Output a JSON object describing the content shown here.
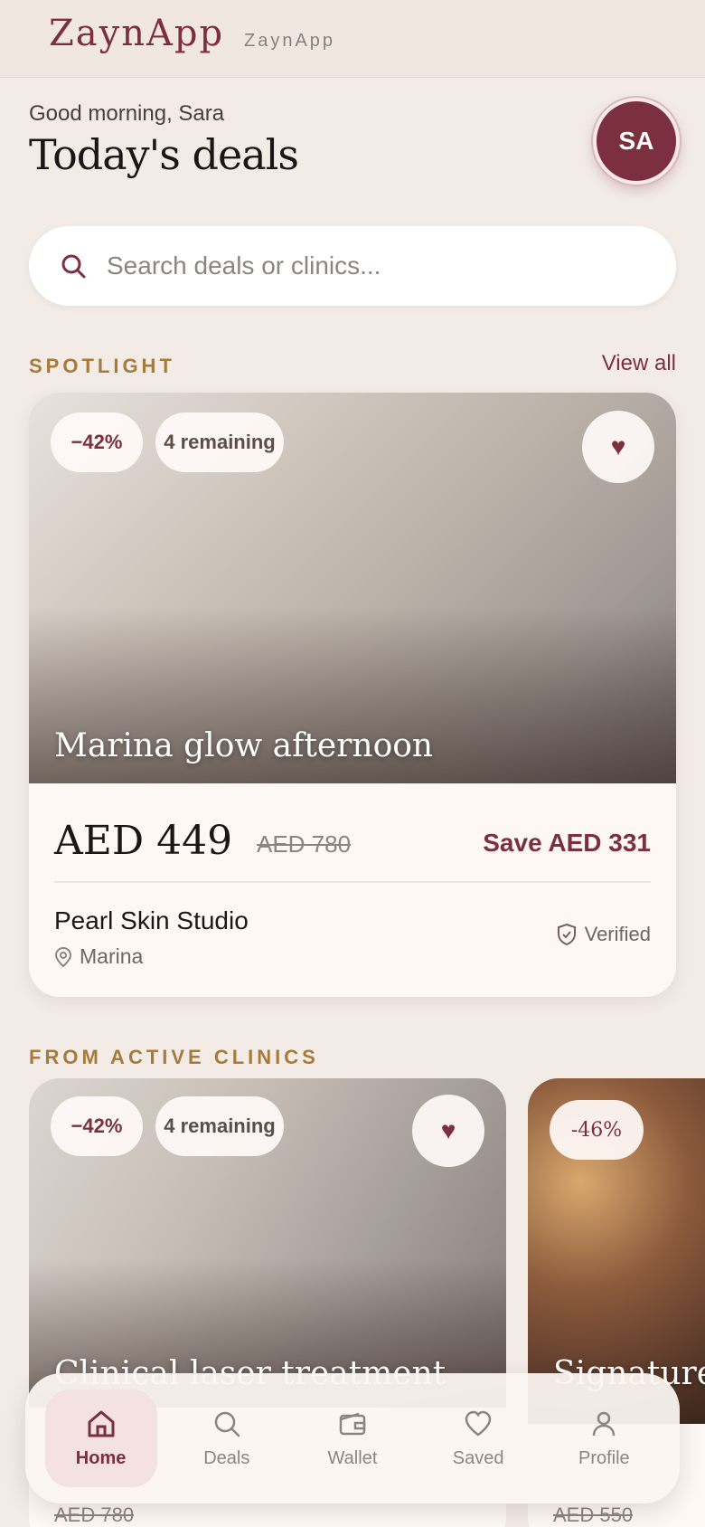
{
  "brand": {
    "logo": "ZaynApp",
    "subtitle": "ZaynApp"
  },
  "header": {
    "greeting": "Good morning, Sara",
    "title": "Today's deals",
    "avatar_initials": "SA"
  },
  "search": {
    "placeholder": "Search deals or clinics..."
  },
  "spotlight": {
    "label": "SPOTLIGHT",
    "view_all": "View all",
    "deal": {
      "discount": "−42%",
      "remaining": "4 remaining",
      "title": "Marina glow afternoon",
      "price": "AED 449",
      "original_price": "AED 780",
      "savings": "Save AED 331",
      "clinic": "Pearl Skin Studio",
      "location": "Marina",
      "verified": "Verified"
    }
  },
  "active_clinics": {
    "label": "FROM ACTIVE CLINICS",
    "deals": [
      {
        "discount": "−42%",
        "remaining": "4 remaining",
        "title": "Clinical laser treatment",
        "original_price": "AED 780"
      },
      {
        "discount": "-46%",
        "title": "Signature F",
        "original_price": "AED 550"
      }
    ]
  },
  "nav": {
    "items": [
      {
        "label": "Home",
        "icon": "home-icon",
        "active": true
      },
      {
        "label": "Deals",
        "icon": "search-icon"
      },
      {
        "label": "Wallet",
        "icon": "wallet-icon"
      },
      {
        "label": "Saved",
        "icon": "heart-icon"
      },
      {
        "label": "Profile",
        "icon": "user-icon"
      }
    ]
  },
  "colors": {
    "accent": "#7c2f3e",
    "gold": "#a67a3c",
    "background": "#f3ece6"
  }
}
